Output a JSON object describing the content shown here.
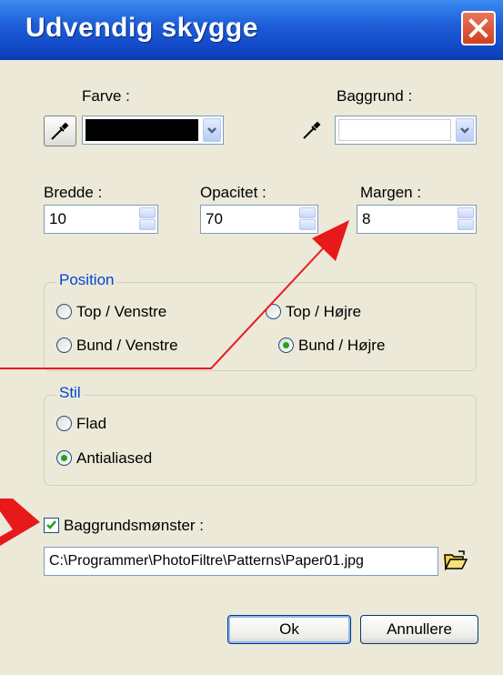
{
  "window": {
    "title": "Udvendig skygge"
  },
  "color": {
    "label": "Farve :",
    "value_color": "#000000"
  },
  "background": {
    "label": "Baggrund :",
    "value_color": "#ffffff"
  },
  "width": {
    "label": "Bredde :",
    "value": "10"
  },
  "opacity": {
    "label": "Opacitet :",
    "value": "70"
  },
  "margin": {
    "label": "Margen :",
    "value": "8"
  },
  "position": {
    "legend": "Position",
    "options": [
      {
        "label": "Top / Venstre",
        "selected": false
      },
      {
        "label": "Top / Højre",
        "selected": false
      },
      {
        "label": "Bund / Venstre",
        "selected": false
      },
      {
        "label": "Bund / Højre",
        "selected": true
      }
    ]
  },
  "style": {
    "legend": "Stil",
    "options": [
      {
        "label": "Flad",
        "selected": false
      },
      {
        "label": "Antialiased",
        "selected": true
      }
    ]
  },
  "pattern": {
    "label": "Baggrundsmønster :",
    "checked": true,
    "path": "C:\\Programmer\\PhotoFiltre\\Patterns\\Paper01.jpg"
  },
  "buttons": {
    "ok": "Ok",
    "cancel": "Annullere"
  },
  "annotation_color": "#e8191b"
}
